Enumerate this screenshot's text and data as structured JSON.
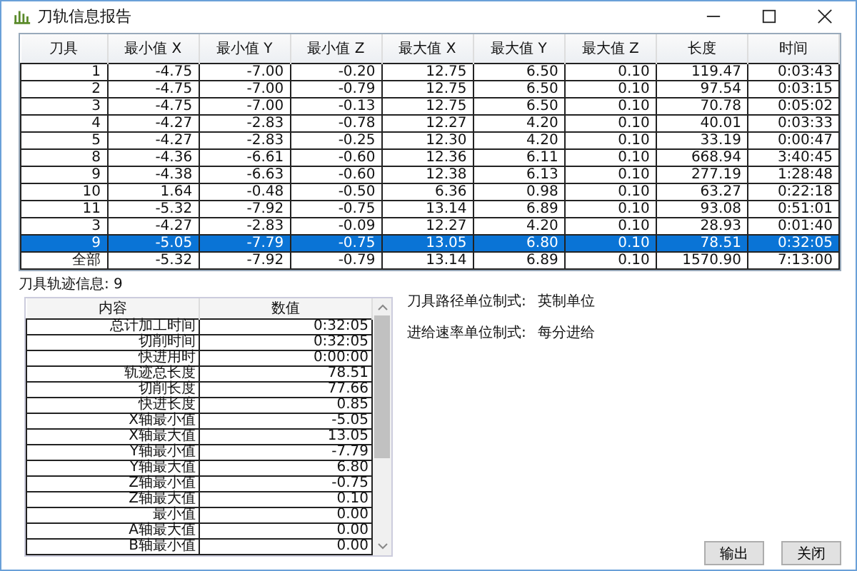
{
  "window": {
    "title": "刀轨信息报告"
  },
  "table": {
    "columns": [
      "刀具",
      "最小值 X",
      "最小值 Y",
      "最小值 Z",
      "最大值 X",
      "最大值 Y",
      "最大值 Z",
      "长度",
      "时间"
    ],
    "rows": [
      {
        "cells": [
          "1",
          "-4.75",
          "-7.00",
          "-0.20",
          "12.75",
          "6.50",
          "0.10",
          "119.47",
          "0:03:43"
        ],
        "selected": false
      },
      {
        "cells": [
          "2",
          "-4.75",
          "-7.00",
          "-0.79",
          "12.75",
          "6.50",
          "0.10",
          "97.54",
          "0:03:15"
        ],
        "selected": false
      },
      {
        "cells": [
          "3",
          "-4.75",
          "-7.00",
          "-0.13",
          "12.75",
          "6.50",
          "0.10",
          "70.78",
          "0:05:02"
        ],
        "selected": false
      },
      {
        "cells": [
          "4",
          "-4.27",
          "-2.83",
          "-0.78",
          "12.27",
          "4.20",
          "0.10",
          "40.01",
          "0:03:33"
        ],
        "selected": false
      },
      {
        "cells": [
          "5",
          "-4.27",
          "-2.83",
          "-0.25",
          "12.30",
          "4.20",
          "0.10",
          "33.19",
          "0:00:47"
        ],
        "selected": false
      },
      {
        "cells": [
          "8",
          "-4.36",
          "-6.61",
          "-0.60",
          "12.36",
          "6.11",
          "0.10",
          "668.94",
          "3:40:45"
        ],
        "selected": false
      },
      {
        "cells": [
          "9",
          "-4.38",
          "-6.63",
          "-0.60",
          "12.38",
          "6.13",
          "0.10",
          "277.19",
          "1:28:48"
        ],
        "selected": false
      },
      {
        "cells": [
          "10",
          "1.64",
          "-0.48",
          "-0.50",
          "6.36",
          "0.98",
          "0.10",
          "63.27",
          "0:22:18"
        ],
        "selected": false
      },
      {
        "cells": [
          "11",
          "-5.32",
          "-7.92",
          "-0.75",
          "13.14",
          "6.89",
          "0.10",
          "93.08",
          "0:51:01"
        ],
        "selected": false
      },
      {
        "cells": [
          "3",
          "-4.27",
          "-2.83",
          "-0.09",
          "12.27",
          "4.20",
          "0.10",
          "28.93",
          "0:01:40"
        ],
        "selected": false
      },
      {
        "cells": [
          "9",
          "-5.05",
          "-7.79",
          "-0.75",
          "13.05",
          "6.80",
          "0.10",
          "78.51",
          "0:32:05"
        ],
        "selected": true
      },
      {
        "cells": [
          "全部",
          "-5.32",
          "-7.92",
          "-0.79",
          "13.14",
          "6.89",
          "0.10",
          "1570.90",
          "7:13:00"
        ],
        "selected": false
      }
    ]
  },
  "track_info": {
    "title": "刀具轨迹信息: 9",
    "columns": [
      "内容",
      "数值"
    ],
    "rows": [
      [
        "总计加工时间",
        "0:32:05"
      ],
      [
        "切削时间",
        "0:32:05"
      ],
      [
        "快进用时",
        "0:00:00"
      ],
      [
        "轨迹总长度",
        "78.51"
      ],
      [
        "切削长度",
        "77.66"
      ],
      [
        "快进长度",
        "0.85"
      ],
      [
        "X轴最小值",
        "-5.05"
      ],
      [
        "X轴最大值",
        "13.05"
      ],
      [
        "Y轴最小值",
        "-7.79"
      ],
      [
        "Y轴最大值",
        "6.80"
      ],
      [
        "Z轴最小值",
        "-0.75"
      ],
      [
        "Z轴最大值",
        "0.10"
      ],
      [
        "最小值",
        "0.00"
      ],
      [
        "A轴最大值",
        "0.00"
      ],
      [
        "B轴最小值",
        "0.00"
      ]
    ]
  },
  "units": [
    {
      "label": "刀具路径单位制式:",
      "value": "英制单位"
    },
    {
      "label": "进给速率单位制式:",
      "value": "每分进给"
    }
  ],
  "buttons": [
    "输出",
    "关闭"
  ]
}
